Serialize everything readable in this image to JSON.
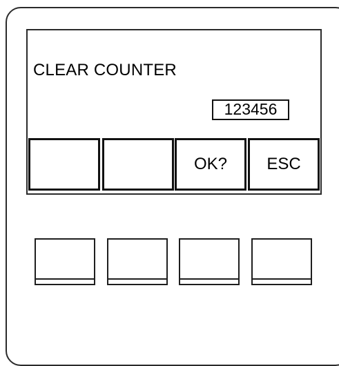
{
  "screen": {
    "title": "CLEAR COUNTER",
    "counter_value": "123456"
  },
  "softkeys": [
    {
      "label": ""
    },
    {
      "label": ""
    },
    {
      "label": "OK?"
    },
    {
      "label": "ESC"
    }
  ],
  "hardware_keys": [
    {
      "label": ""
    },
    {
      "label": ""
    },
    {
      "label": ""
    },
    {
      "label": ""
    }
  ]
}
